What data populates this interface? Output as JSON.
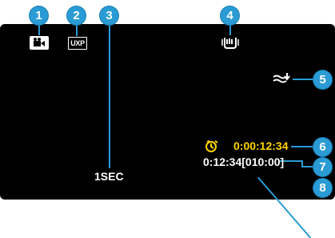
{
  "callouts": [
    "1",
    "2",
    "3",
    "4",
    "5",
    "6",
    "7",
    "8"
  ],
  "screen": {
    "mode_icon": "video-mode-icon",
    "quality_label": "UXP",
    "interval_label": "1SEC",
    "stabilizer_icon": "image-stabilizer-icon",
    "wind_icon": "wind-cut-icon",
    "timer_icon": "time-lapse-clock-icon",
    "counter": "0:00:12:34",
    "remaining": "0:12:34[010:00]"
  },
  "colors": {
    "callout": "#2a9bd4",
    "screen": "#000000",
    "counter": "#ffd400",
    "icon": "#ffffff"
  }
}
